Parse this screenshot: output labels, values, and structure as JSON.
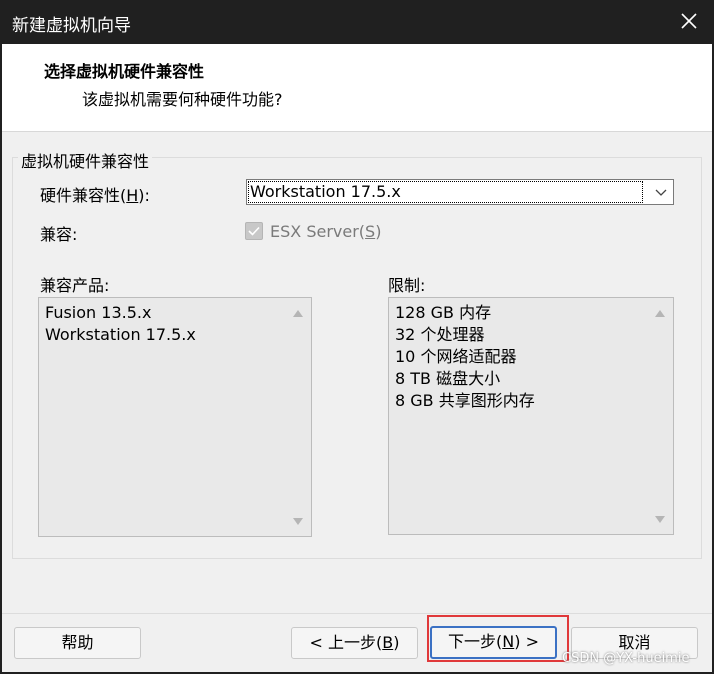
{
  "window": {
    "title": "新建虚拟机向导"
  },
  "header": {
    "heading": "选择虚拟机硬件兼容性",
    "subheading": "该虚拟机需要何种硬件功能?"
  },
  "group": {
    "legend": "虚拟机硬件兼容性",
    "hw_compat_label": "硬件兼容性(H):",
    "hw_compat_value": "Workstation 17.5.x",
    "compat_label": "兼容:",
    "esx_checkbox_label": "ESX Server(S)",
    "esx_checked": true,
    "products_label": "兼容产品:",
    "products": [
      "Fusion 13.5.x",
      "Workstation 17.5.x"
    ],
    "limits_label": "限制:",
    "limits": [
      "128 GB 内存",
      "32 个处理器",
      "10 个网络适配器",
      "8 TB 磁盘大小",
      "8 GB 共享图形内存"
    ]
  },
  "buttons": {
    "help": "帮助",
    "back": "< 上一步(B)",
    "next": "下一步(N) >",
    "cancel": "取消"
  },
  "watermark": "CSDN @YX-hueimie",
  "colors": {
    "highlight": "#e0383a",
    "primary_border": "#3b71c4"
  }
}
